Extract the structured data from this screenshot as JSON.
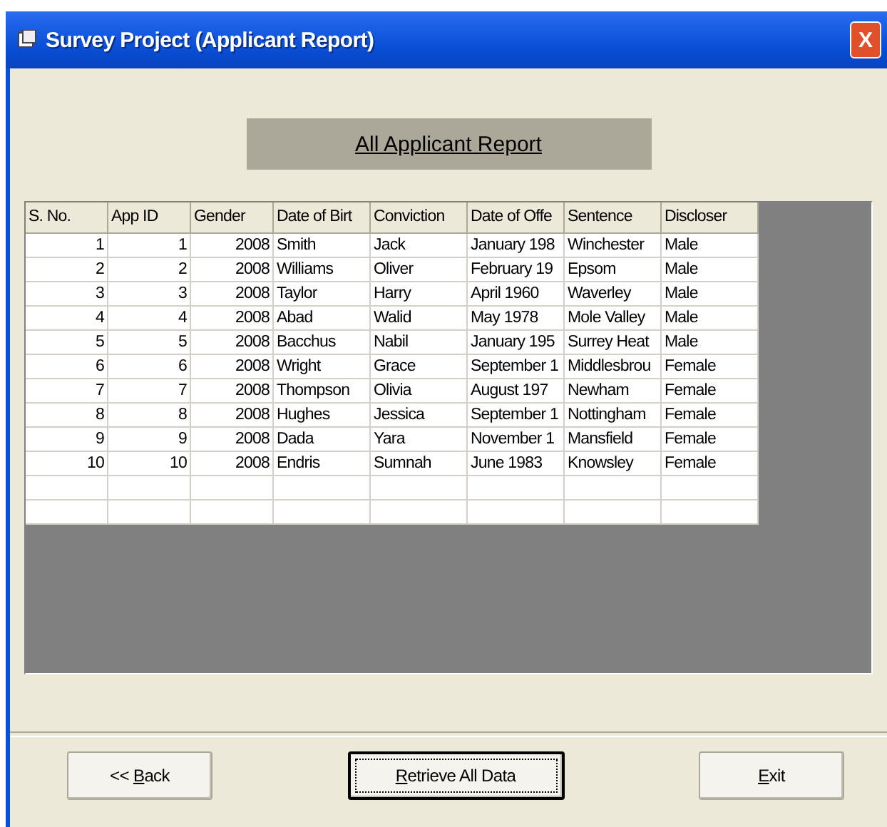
{
  "window": {
    "title": "Survey Project (Applicant Report)",
    "close": "X"
  },
  "report_heading": "All Applicant Report",
  "table": {
    "columns": [
      "S. No.",
      "App ID",
      "Gender",
      "Date of Birt",
      "Conviction",
      "Date of Offe",
      "Sentence",
      "Discloser"
    ],
    "rows": [
      [
        "1",
        "1",
        "2008",
        "Smith",
        "Jack",
        "January 198",
        "Winchester",
        "Male"
      ],
      [
        "2",
        "2",
        "2008",
        "Williams",
        "Oliver",
        "February 19",
        "Epsom",
        "Male"
      ],
      [
        "3",
        "3",
        "2008",
        "Taylor",
        "Harry",
        "April 1960",
        "Waverley",
        "Male"
      ],
      [
        "4",
        "4",
        "2008",
        "Abad",
        "Walid",
        "May 1978",
        "Mole Valley",
        "Male"
      ],
      [
        "5",
        "5",
        "2008",
        "Bacchus",
        "Nabil",
        "January 195",
        "Surrey Heat",
        "Male"
      ],
      [
        "6",
        "6",
        "2008",
        "Wright",
        "Grace",
        "September 1",
        "Middlesbrou",
        "Female"
      ],
      [
        "7",
        "7",
        "2008",
        "Thompson",
        "Olivia",
        "August 197",
        "Newham",
        "Female"
      ],
      [
        "8",
        "8",
        "2008",
        "Hughes",
        "Jessica",
        "September 1",
        "Nottingham",
        "Female"
      ],
      [
        "9",
        "9",
        "2008",
        "Dada",
        "Yara",
        "November 1",
        "Mansfield",
        "Female"
      ],
      [
        "10",
        "10",
        "2008",
        "Endris",
        "Sumnah",
        "June 1983",
        "Knowsley",
        "Female"
      ]
    ]
  },
  "buttons": [
    {
      "prefix": "<< ",
      "access_key": "B",
      "rest": "ack",
      "focused": false
    },
    {
      "access_key": "R",
      "rest": "etrieve All Data",
      "focused": true
    },
    {
      "access_key": "E",
      "rest": "xit",
      "focused": false
    }
  ]
}
